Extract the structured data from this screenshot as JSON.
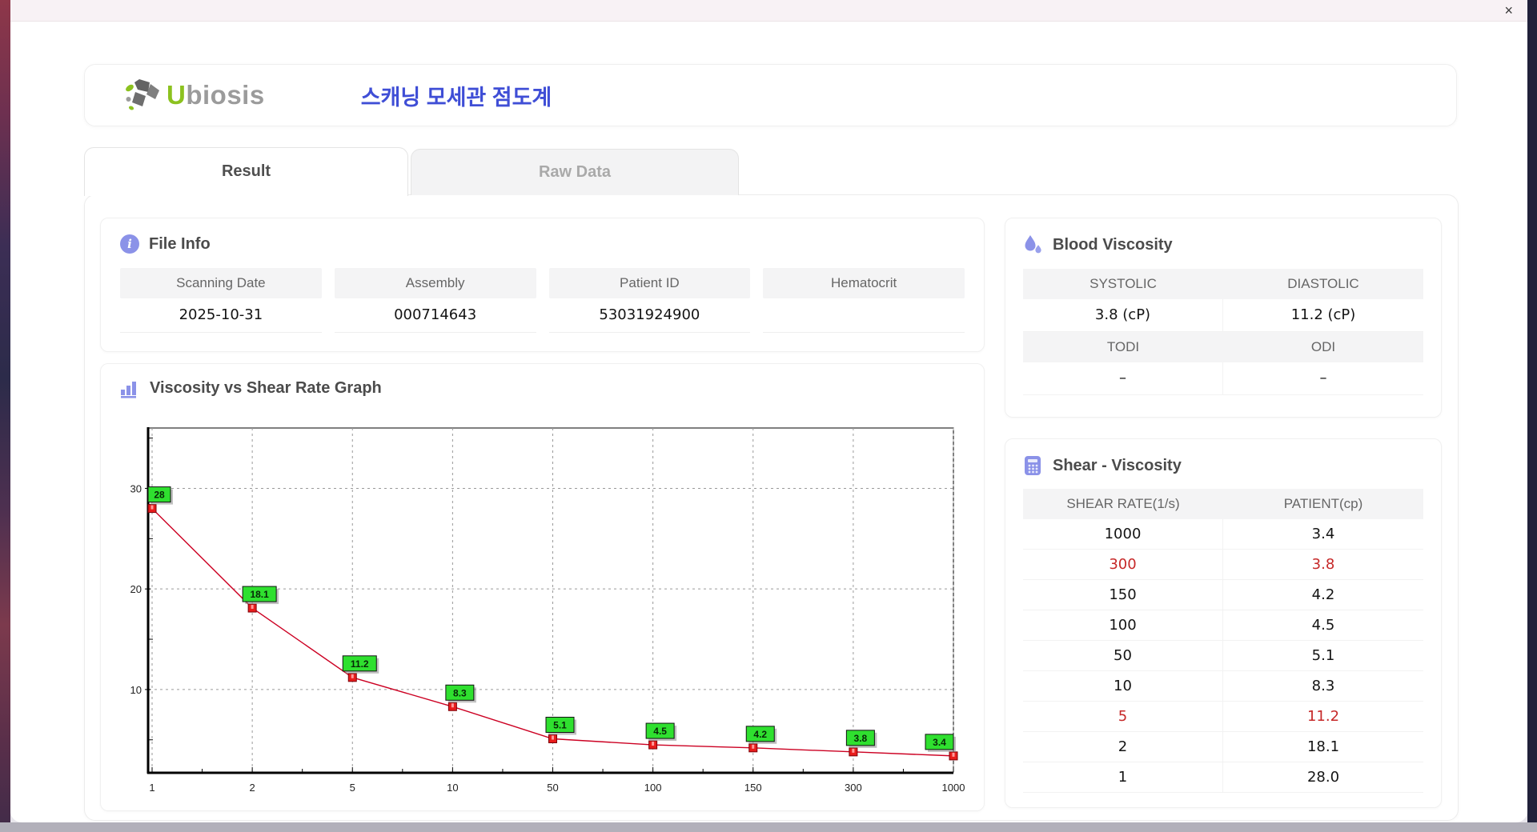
{
  "window": {
    "close_label": "×"
  },
  "header": {
    "logo_u": "U",
    "logo_rest": "biosis",
    "subtitle": "스캐닝 모세관 점도계"
  },
  "tabs": {
    "result": "Result",
    "raw_data": "Raw Data"
  },
  "file_info": {
    "title": "File Info",
    "fields": [
      {
        "label": "Scanning Date",
        "value": "2025-10-31"
      },
      {
        "label": "Assembly",
        "value": "000714643"
      },
      {
        "label": "Patient ID",
        "value": "53031924900"
      },
      {
        "label": "Hematocrit",
        "value": ""
      }
    ]
  },
  "blood_viscosity": {
    "title": "Blood Viscosity",
    "pairs": [
      {
        "h1": "SYSTOLIC",
        "h2": "DIASTOLIC",
        "v1": "3.8 (cP)",
        "v2": "11.2 (cP)"
      },
      {
        "h1": "TODI",
        "h2": "ODI",
        "v1": "–",
        "v2": "–"
      }
    ]
  },
  "shear_viscosity": {
    "title": "Shear - Viscosity",
    "columns": [
      "SHEAR RATE(1/s)",
      "PATIENT(cp)"
    ],
    "rows": [
      {
        "shear": "1000",
        "patient": "3.4",
        "highlight": false
      },
      {
        "shear": "300",
        "patient": "3.8",
        "highlight": true
      },
      {
        "shear": "150",
        "patient": "4.2",
        "highlight": false
      },
      {
        "shear": "100",
        "patient": "4.5",
        "highlight": false
      },
      {
        "shear": "50",
        "patient": "5.1",
        "highlight": false
      },
      {
        "shear": "10",
        "patient": "8.3",
        "highlight": false
      },
      {
        "shear": "5",
        "patient": "11.2",
        "highlight": true
      },
      {
        "shear": "2",
        "patient": "18.1",
        "highlight": false
      },
      {
        "shear": "1",
        "patient": "28.0",
        "highlight": false
      }
    ]
  },
  "graph": {
    "title": "Viscosity vs Shear Rate Graph"
  },
  "chart_data": {
    "type": "line",
    "title": "Viscosity vs Shear Rate Graph",
    "x_categories": [
      1,
      2,
      5,
      10,
      50,
      100,
      150,
      300,
      1000
    ],
    "values": [
      28,
      18.1,
      11.2,
      8.3,
      5.1,
      4.5,
      4.2,
      3.8,
      3.4
    ],
    "point_labels": [
      "28",
      "18.1",
      "11.2",
      "8.3",
      "5.1",
      "4.5",
      "4.2",
      "3.8",
      "3.4"
    ],
    "xlabel": "",
    "ylabel": "",
    "y_ticks": [
      10,
      20,
      30
    ],
    "ylim": [
      1.8,
      36
    ],
    "x_axis_style": "categorical-log",
    "grid": "dashed",
    "legend": "none",
    "line_color": "#cc0022",
    "marker_color": "#e81c1c",
    "marker_edge": "#7d0008",
    "label_bg": "#2fe02f",
    "label_edge": "#111111"
  },
  "colors": {
    "accent_purple": "#8b92e8",
    "brand_green": "#8cc21f",
    "subtitle_blue": "#3f4ed6",
    "highlight_red": "#c62828"
  }
}
